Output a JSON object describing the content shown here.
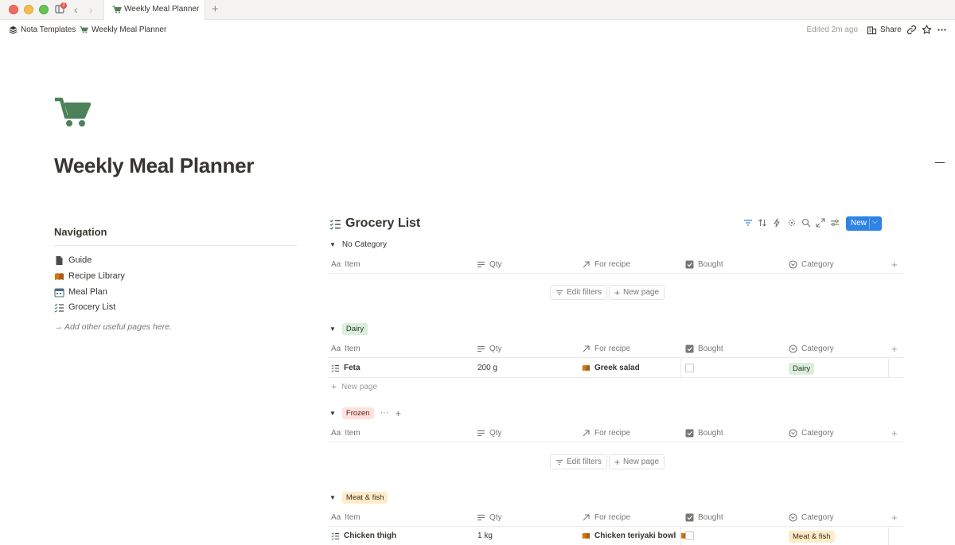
{
  "window": {
    "tab_title": "Weekly Meal Planner",
    "notification_count": "2"
  },
  "topbar": {
    "workspace": "Nota Templates",
    "page": "Weekly Meal Planner",
    "edited": "Edited 2m ago",
    "share_label": "Share"
  },
  "page": {
    "title": "Weekly Meal Planner",
    "icon": "shopping-cart-icon",
    "icon_color": "#4d8159"
  },
  "navigation": {
    "heading": "Navigation",
    "items": [
      {
        "label": "Guide",
        "icon": "document-icon"
      },
      {
        "label": "Recipe Library",
        "icon": "books-icon"
      },
      {
        "label": "Meal Plan",
        "icon": "calendar-icon"
      },
      {
        "label": "Grocery List",
        "icon": "checklist-icon"
      }
    ],
    "note": "→ Add other useful pages here."
  },
  "database": {
    "title": "Grocery List",
    "new_label": "New",
    "accent_color": "#2f83e4",
    "columns": {
      "item": "Item",
      "qty": "Qty",
      "recipe": "For recipe",
      "bought": "Bought",
      "category": "Category"
    },
    "edit_filters_label": "Edit filters",
    "new_page_label": "New page",
    "groups": [
      {
        "name": "No Category",
        "rows": []
      },
      {
        "name": "Dairy",
        "color": "#dbeddb",
        "rows": [
          {
            "item": "Feta",
            "qty": "200 g",
            "recipe": "Greek salad",
            "bought": false,
            "category": "Dairy"
          }
        ]
      },
      {
        "name": "Frozen",
        "color": "#ffe2dd",
        "rows": []
      },
      {
        "name": "Meat & fish",
        "color": "#fdecc8",
        "rows": [
          {
            "item": "Chicken thigh",
            "qty": "1 kg",
            "recipe": "Chicken teriyaki bowl",
            "bought": false,
            "category": "Meat & fish"
          }
        ]
      }
    ]
  }
}
